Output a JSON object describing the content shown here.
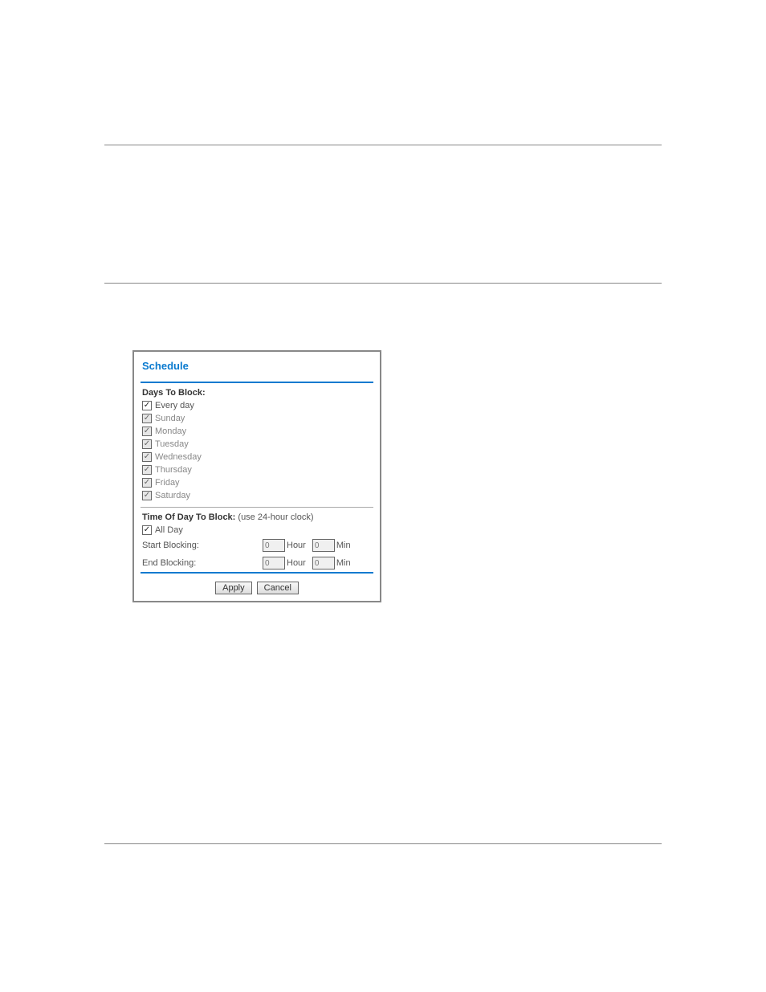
{
  "panel": {
    "title": "Schedule",
    "days_section": {
      "heading": "Days To Block:",
      "items": [
        {
          "label": "Every day",
          "checked": true,
          "disabled": false
        },
        {
          "label": "Sunday",
          "checked": true,
          "disabled": true
        },
        {
          "label": "Monday",
          "checked": true,
          "disabled": true
        },
        {
          "label": "Tuesday",
          "checked": true,
          "disabled": true
        },
        {
          "label": "Wednesday",
          "checked": true,
          "disabled": true
        },
        {
          "label": "Thursday",
          "checked": true,
          "disabled": true
        },
        {
          "label": "Friday",
          "checked": true,
          "disabled": true
        },
        {
          "label": "Saturday",
          "checked": true,
          "disabled": true
        }
      ]
    },
    "time_section": {
      "heading": "Time Of Day To Block:",
      "heading_note": "(use 24-hour clock)",
      "all_day": {
        "label": "All Day",
        "checked": true
      },
      "start_label": "Start Blocking:",
      "end_label": "End Blocking:",
      "hour_unit": "Hour",
      "min_unit": "Min",
      "start_hour": "0",
      "start_min": "0",
      "end_hour": "0",
      "end_min": "0"
    },
    "buttons": {
      "apply": "Apply",
      "cancel": "Cancel"
    }
  }
}
